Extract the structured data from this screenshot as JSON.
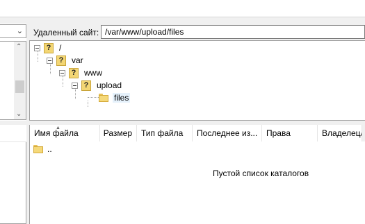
{
  "remote": {
    "site_label": "Удаленный сайт:",
    "path_value": "/var/www/upload/files",
    "tree": [
      {
        "label": "/",
        "icon": "unknown-folder-icon"
      },
      {
        "label": "var",
        "icon": "unknown-folder-icon"
      },
      {
        "label": "www",
        "icon": "unknown-folder-icon"
      },
      {
        "label": "upload",
        "icon": "unknown-folder-icon"
      },
      {
        "label": "files",
        "icon": "folder-icon",
        "selected": true
      }
    ],
    "columns": [
      "Имя файла",
      "Размер",
      "Тип файла",
      "Последнее из...",
      "Права",
      "Владелец/..."
    ],
    "rows": [
      {
        "name": "..",
        "icon": "folder-icon"
      }
    ],
    "empty_message": "Пустой список каталогов"
  },
  "colors": {
    "panel_bg": "#f0f0f0",
    "border": "#a0a0a0",
    "folder": "#f5d97a",
    "selection": "#e5f1fb"
  }
}
